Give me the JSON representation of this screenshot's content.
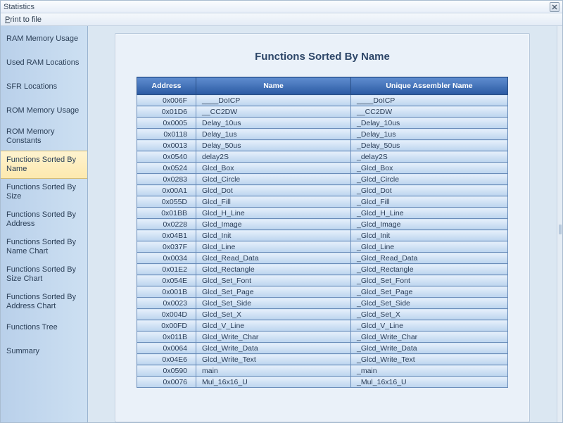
{
  "window": {
    "title": "Statistics"
  },
  "menu": {
    "print_to_file": "Print to file"
  },
  "sidebar": {
    "items": [
      {
        "label": "RAM Memory Usage"
      },
      {
        "label": "Used RAM Locations"
      },
      {
        "label": "SFR Locations"
      },
      {
        "label": "ROM Memory Usage"
      },
      {
        "label": "ROM Memory Constants"
      },
      {
        "label": "Functions Sorted By  Name"
      },
      {
        "label": "Functions Sorted By Size"
      },
      {
        "label": "Functions Sorted By Address"
      },
      {
        "label": "Functions Sorted By Name Chart"
      },
      {
        "label": "Functions Sorted By Size Chart"
      },
      {
        "label": "Functions Sorted By Address Chart"
      },
      {
        "label": "Functions Tree"
      },
      {
        "label": "Summary"
      }
    ],
    "selected_index": 5
  },
  "page": {
    "title": "Functions Sorted By Name",
    "columns": [
      "Address",
      "Name",
      "Unique Assembler Name"
    ],
    "rows": [
      {
        "addr": "0x006F",
        "name": "____DoICP",
        "uname": "____DoICP"
      },
      {
        "addr": "0x01D6",
        "name": "__CC2DW",
        "uname": "__CC2DW"
      },
      {
        "addr": "0x0005",
        "name": "Delay_10us",
        "uname": "_Delay_10us"
      },
      {
        "addr": "0x0118",
        "name": "Delay_1us",
        "uname": "_Delay_1us"
      },
      {
        "addr": "0x0013",
        "name": "Delay_50us",
        "uname": "_Delay_50us"
      },
      {
        "addr": "0x0540",
        "name": "delay2S",
        "uname": "_delay2S"
      },
      {
        "addr": "0x0524",
        "name": "Glcd_Box",
        "uname": "_Glcd_Box"
      },
      {
        "addr": "0x0283",
        "name": "Glcd_Circle",
        "uname": "_Glcd_Circle"
      },
      {
        "addr": "0x00A1",
        "name": "Glcd_Dot",
        "uname": "_Glcd_Dot"
      },
      {
        "addr": "0x055D",
        "name": "Glcd_Fill",
        "uname": "_Glcd_Fill"
      },
      {
        "addr": "0x01BB",
        "name": "Glcd_H_Line",
        "uname": "_Glcd_H_Line"
      },
      {
        "addr": "0x0228",
        "name": "Glcd_Image",
        "uname": "_Glcd_Image"
      },
      {
        "addr": "0x04B1",
        "name": "Glcd_Init",
        "uname": "_Glcd_Init"
      },
      {
        "addr": "0x037F",
        "name": "Glcd_Line",
        "uname": "_Glcd_Line"
      },
      {
        "addr": "0x0034",
        "name": "Glcd_Read_Data",
        "uname": "_Glcd_Read_Data"
      },
      {
        "addr": "0x01E2",
        "name": "Glcd_Rectangle",
        "uname": "_Glcd_Rectangle"
      },
      {
        "addr": "0x054E",
        "name": "Glcd_Set_Font",
        "uname": "_Glcd_Set_Font"
      },
      {
        "addr": "0x001B",
        "name": "Glcd_Set_Page",
        "uname": "_Glcd_Set_Page"
      },
      {
        "addr": "0x0023",
        "name": "Glcd_Set_Side",
        "uname": "_Glcd_Set_Side"
      },
      {
        "addr": "0x004D",
        "name": "Glcd_Set_X",
        "uname": "_Glcd_Set_X"
      },
      {
        "addr": "0x00FD",
        "name": "Glcd_V_Line",
        "uname": "_Glcd_V_Line"
      },
      {
        "addr": "0x011B",
        "name": "Glcd_Write_Char",
        "uname": "_Glcd_Write_Char"
      },
      {
        "addr": "0x0064",
        "name": "Glcd_Write_Data",
        "uname": "_Glcd_Write_Data"
      },
      {
        "addr": "0x04E6",
        "name": "Glcd_Write_Text",
        "uname": "_Glcd_Write_Text"
      },
      {
        "addr": "0x0590",
        "name": "main",
        "uname": "_main"
      },
      {
        "addr": "0x0076",
        "name": "Mul_16x16_U",
        "uname": "_Mul_16x16_U"
      }
    ]
  }
}
